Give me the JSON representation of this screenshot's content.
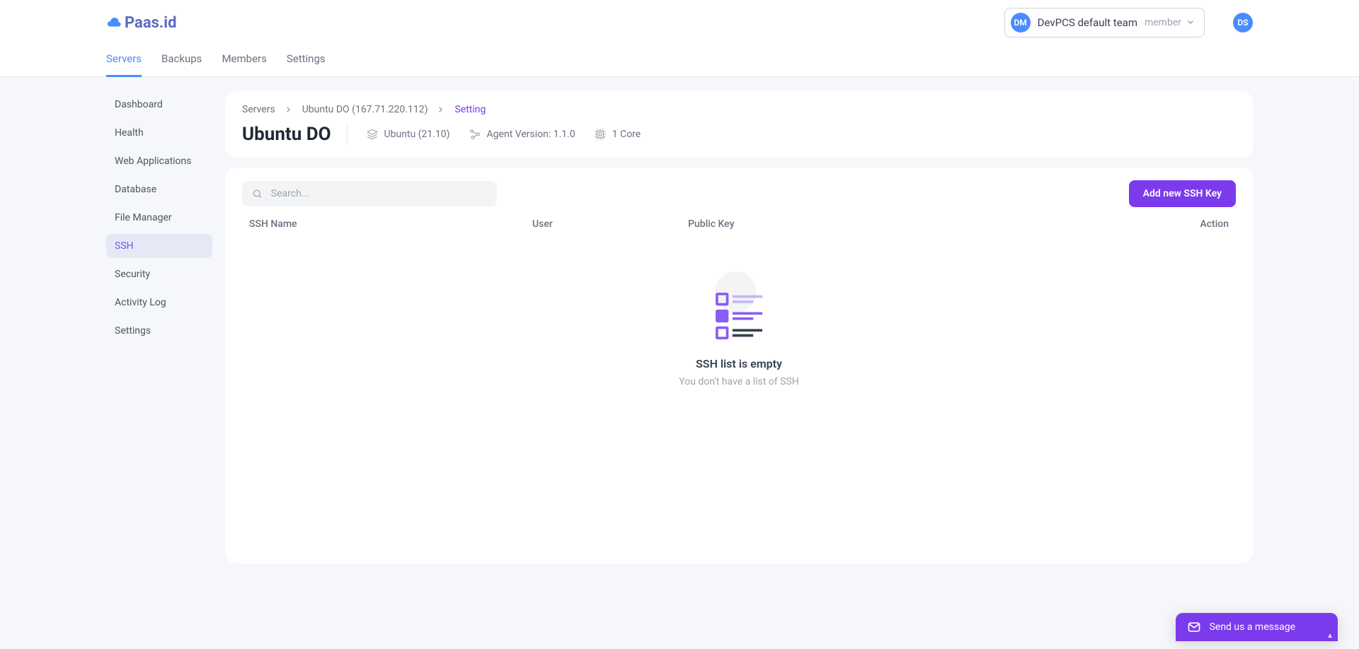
{
  "brand": {
    "name": "Paas.id"
  },
  "team_selector": {
    "avatar_initials": "DM",
    "team_name": "DevPCS default team",
    "role": "member"
  },
  "user": {
    "initials": "DS"
  },
  "top_tabs": {
    "servers": "Servers",
    "backups": "Backups",
    "members": "Members",
    "settings": "Settings"
  },
  "sidebar": {
    "dashboard": "Dashboard",
    "health": "Health",
    "webapps": "Web Applications",
    "database": "Database",
    "filemanager": "File Manager",
    "ssh": "SSH",
    "security": "Security",
    "activity": "Activity Log",
    "settings": "Settings"
  },
  "breadcrumb": {
    "root": "Servers",
    "server": "Ubuntu DO (167.71.220.112)",
    "current": "Setting"
  },
  "server": {
    "name": "Ubuntu DO",
    "os": "Ubuntu (21.10)",
    "agent": "Agent Version: 1.1.0",
    "cores": "1 Core"
  },
  "ssh_panel": {
    "search_placeholder": "Search...",
    "add_button": "Add new SSH Key",
    "columns": {
      "name": "SSH Name",
      "user": "User",
      "key": "Public Key",
      "action": "Action"
    },
    "empty_title": "SSH list is empty",
    "empty_subtitle": "You don't have a list of SSH"
  },
  "chat": {
    "label": "Send us a message"
  }
}
